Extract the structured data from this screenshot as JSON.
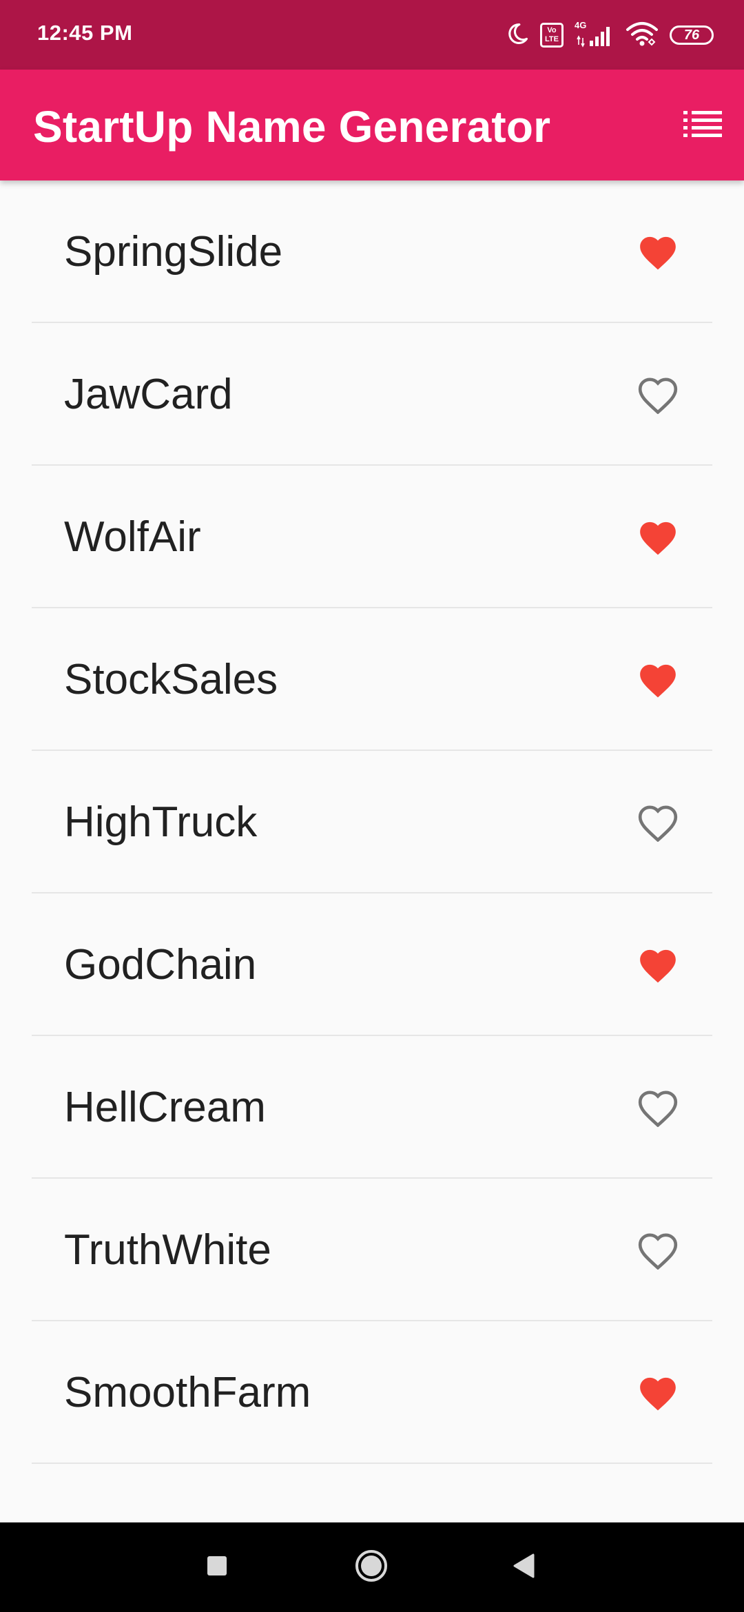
{
  "status_bar": {
    "time": "12:45 PM",
    "volte_label": "Vo LTE",
    "network_label": "4G",
    "battery_level": "76"
  },
  "app_bar": {
    "title": "StartUp Name Generator",
    "list_icon": "list-icon"
  },
  "colors": {
    "status_bar": "#ad1547",
    "app_bar": "#e91e63",
    "heart_saved": "#f44336",
    "heart_unsaved": "#757575"
  },
  "words": [
    {
      "name": "SpringSlide",
      "saved": true
    },
    {
      "name": "JawCard",
      "saved": false
    },
    {
      "name": "WolfAir",
      "saved": true
    },
    {
      "name": "StockSales",
      "saved": true
    },
    {
      "name": "HighTruck",
      "saved": false
    },
    {
      "name": "GodChain",
      "saved": true
    },
    {
      "name": "HellCream",
      "saved": false
    },
    {
      "name": "TruthWhite",
      "saved": false
    },
    {
      "name": "SmoothFarm",
      "saved": true
    }
  ],
  "nav_bar": {
    "recents_icon": "square-icon",
    "home_icon": "circle-icon",
    "back_icon": "triangle-back-icon"
  }
}
